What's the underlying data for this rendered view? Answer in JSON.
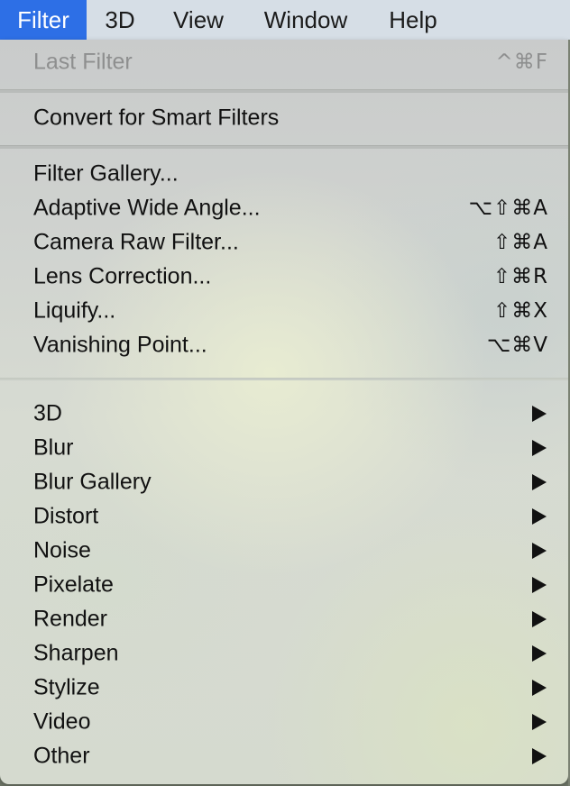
{
  "menubar": {
    "items": [
      {
        "label": "Filter",
        "active": true
      },
      {
        "label": "3D"
      },
      {
        "label": "View"
      },
      {
        "label": "Window"
      },
      {
        "label": "Help"
      }
    ]
  },
  "menu": {
    "last_filter": {
      "label": "Last Filter",
      "shortcut": "^⌘F",
      "enabled": false
    },
    "convert": {
      "label": "Convert for Smart Filters"
    },
    "gallery_items": [
      {
        "label": "Filter Gallery...",
        "shortcut": ""
      },
      {
        "label": "Adaptive Wide Angle...",
        "shortcut": "⌥⇧⌘A"
      },
      {
        "label": "Camera Raw Filter...",
        "shortcut": "⇧⌘A"
      },
      {
        "label": "Lens Correction...",
        "shortcut": "⇧⌘R"
      },
      {
        "label": "Liquify...",
        "shortcut": "⇧⌘X"
      },
      {
        "label": "Vanishing Point...",
        "shortcut": "⌥⌘V"
      }
    ],
    "submenus": [
      {
        "label": "3D"
      },
      {
        "label": "Blur"
      },
      {
        "label": "Blur Gallery"
      },
      {
        "label": "Distort"
      },
      {
        "label": "Noise"
      },
      {
        "label": "Pixelate"
      },
      {
        "label": "Render"
      },
      {
        "label": "Sharpen"
      },
      {
        "label": "Stylize"
      },
      {
        "label": "Video"
      },
      {
        "label": "Other"
      }
    ],
    "submenu_icon": "chevron-right-icon"
  }
}
